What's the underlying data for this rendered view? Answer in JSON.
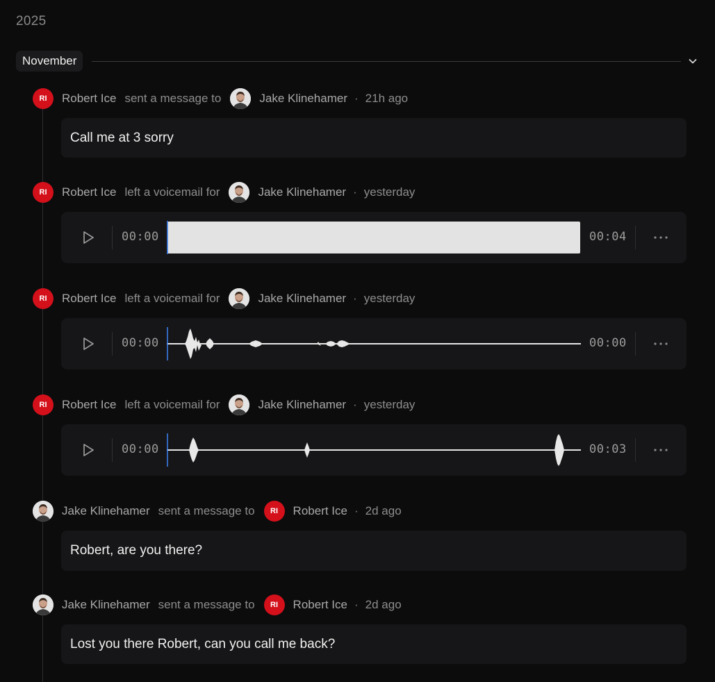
{
  "year": "2025",
  "month": {
    "label": "November"
  },
  "entries": [
    {
      "type": "message",
      "sender": "Robert Ice",
      "sender_initials": "RI",
      "verb": "sent a message to",
      "recipient": "Jake Klinehamer",
      "time": "21h ago",
      "text": "Call me at 3 sorry"
    },
    {
      "type": "voicemail",
      "sender": "Robert Ice",
      "sender_initials": "RI",
      "verb": "left a voicemail for",
      "recipient": "Jake Klinehamer",
      "time": "yesterday",
      "current": "00:00",
      "duration": "00:04"
    },
    {
      "type": "voicemail",
      "sender": "Robert Ice",
      "sender_initials": "RI",
      "verb": "left a voicemail for",
      "recipient": "Jake Klinehamer",
      "time": "yesterday",
      "current": "00:00",
      "duration": "00:00"
    },
    {
      "type": "voicemail",
      "sender": "Robert Ice",
      "sender_initials": "RI",
      "verb": "left a voicemail for",
      "recipient": "Jake Klinehamer",
      "time": "yesterday",
      "current": "00:00",
      "duration": "00:03"
    },
    {
      "type": "message",
      "sender": "Jake Klinehamer",
      "verb": "sent a message to",
      "recipient": "Robert Ice",
      "recipient_initials": "RI",
      "time": "2d ago",
      "text": "Robert, are you there?"
    },
    {
      "type": "message",
      "sender": "Jake Klinehamer",
      "verb": "sent a message to",
      "recipient": "Robert Ice",
      "recipient_initials": "RI",
      "time": "2d ago",
      "text": "Lost you there Robert, can you call me back?"
    }
  ],
  "dot": "·",
  "colors": {
    "background": "#0c0c0d",
    "card": "#161618",
    "avatar_red": "#d4101b",
    "playhead": "#3b82f6"
  }
}
